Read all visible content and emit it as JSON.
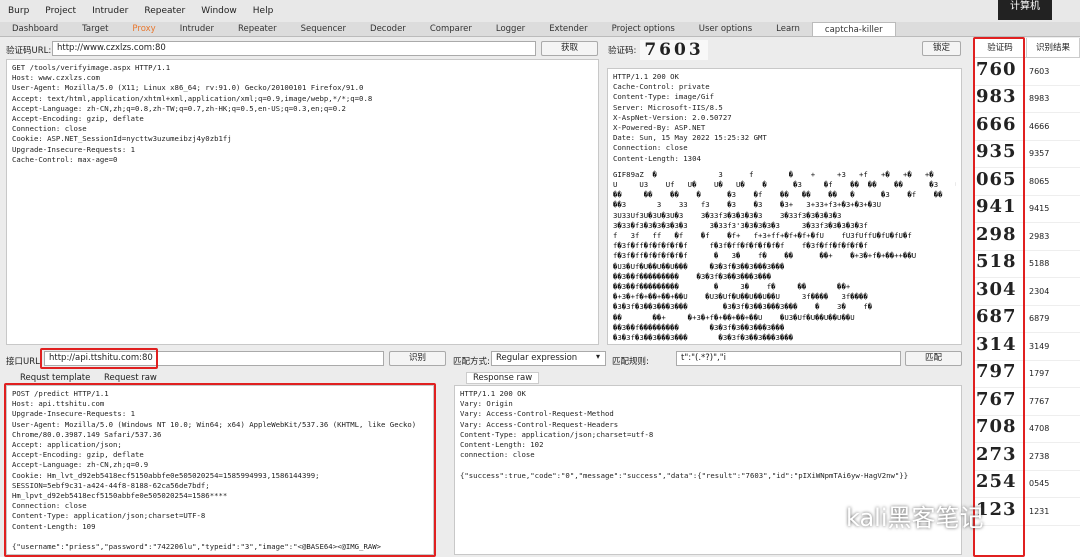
{
  "menu": [
    "Burp",
    "Project",
    "Intruder",
    "Repeater",
    "Window",
    "Help"
  ],
  "corner_text": "计算机",
  "tabs": [
    {
      "label": "Dashboard"
    },
    {
      "label": "Target"
    },
    {
      "label": "Proxy"
    },
    {
      "label": "Intruder"
    },
    {
      "label": "Repeater"
    },
    {
      "label": "Sequencer"
    },
    {
      "label": "Decoder"
    },
    {
      "label": "Comparer"
    },
    {
      "label": "Logger"
    },
    {
      "label": "Extender"
    },
    {
      "label": "Project options"
    },
    {
      "label": "User options"
    },
    {
      "label": "Learn"
    },
    {
      "label": "captcha-killer"
    }
  ],
  "captcha_url": {
    "label": "验证码URL:",
    "value": "http://www.czxlzs.com:80",
    "fetch": "获取"
  },
  "captcha_img": {
    "label": "验证码:",
    "text": "7603",
    "lock": "锁定"
  },
  "request_text": "GET /tools/verifyimage.aspx HTTP/1.1\nHost: www.czxlzs.com\nUser-Agent: Mozilla/5.0 (X11; Linux x86_64; rv:91.0) Gecko/20100101 Firefox/91.0\nAccept: text/html,application/xhtml+xml,application/xml;q=0.9,image/webp,*/*;q=0.8\nAccept-Language: zh-CN,zh;q=0.8,zh-TW;q=0.7,zh-HK;q=0.5,en-US;q=0.3,en;q=0.2\nAccept-Encoding: gzip, deflate\nConnection: close\nCookie: ASP.NET_SessionId=nycttw3uzumeibzj4y0zb1fj\nUpgrade-Insecure-Requests: 1\nCache-Control: max-age=0",
  "response_head": "HTTP/1.1 200 OK\nCache-Control: private\nContent-Type: image/Gif\nServer: Microsoft-IIS/8.5\nX-AspNet-Version: 2.0.50727\nX-Powered-By: ASP.NET\nDate: Sun, 15 May 2022 15:25:32 GMT\nConnection: close\nContent-Length: 1304",
  "response_binary": "GIF89aZ  �              3      f        �    +     +3   +f   +�   +�   +�\nU     U3    Uf   U�    U�   U�    �      �3     �f    ��  ��    ��      �3    �f\n��     ��    ��    �      �3    �f    ��   ��    ��   �      �3    �f    ��    ��\n��3       3    33   f3    �3    �3    �3+   3+33+f3+�3+�3+�3U\n3U33Uf3U�3U�3U�3    3�33f3�3�3�3�3    3�33f3�3�3�3�3\n3�33�f3�3�3�3�3�3     3�33f3'3�3�3�3�3     3�33f3�3�3�3�3f\nf   3f   ff   �f    �f    �f+   f+3+ff+�f+�f+�fU    fU3fUffU�fU�fU�f\nf�3f�ff�f�f�f�f�f     f�3f�ff�f�f�f�f�f    f�3f�ff�f�f�f�f\nf�3f�ff�f�f�f�f�f      �   3�    f�    ��      ��+    �+3�+f�+��++��U\n�U3�Uf�U��U��U���     �3�3f�3��3���3���\n��3��f���������    �3�3f�3��3���3���\n��3��f���������        �     3�    f�     ��       ��+\n�+3�+f�+��+��+��U    �U3�Uf�U��U��U��U     3f����   3f����\n�3�3f�3��3���3���        �3�3f�3��3���3���    �    3�    f�\n��       ��+     �+3�+f�+��+��+��U    �U3�Uf�U��U��U��U\n��3��f���������       �3�3f�3��3���3���\n�3�3f�3��3���3���       �3�3f�3��3���3���",
  "api_url": {
    "label": "接口URL:",
    "value": "http://api.ttshitu.com:80",
    "identify": "识别"
  },
  "match": {
    "mode_label": "匹配方式:",
    "mode_value": "Regular expression",
    "rule_label": "匹配规则:",
    "rule_value": "t\":\"(.*?)\",\"i",
    "button": "匹配"
  },
  "request_tabs": [
    "Requst template",
    "Request raw"
  ],
  "response_tab": "Response raw",
  "api_request": "POST /predict HTTP/1.1\nHost: api.ttshitu.com\nUpgrade-Insecure-Requests: 1\nUser-Agent: Mozilla/5.0 (Windows NT 10.0; Win64; x64) AppleWebKit/537.36 (KHTML, like Gecko)\nChrome/80.0.3987.149 Safari/537.36\nAccept: application/json;\nAccept-Encoding: gzip, deflate\nAccept-Language: zh-CN,zh;q=0.9\nCookie: Hm_lvt_d92eb5418ecf5150abbfe0e505020254=1585994993,1586144399;\nSESSION=5ebf9c31-a424-44f8-8188-62ca56de7bdf; Hm_lpvt_d92eb5418ecf5150abbfe0e505020254=1586****\nConnection: close\nContent-Type: application/json;charset=UTF-8\nContent-Length: 109\n\n{\"username\":\"priess\",\"password\":\"742206lu\",\"typeid\":\"3\",\"image\":\"<@BASE64><@IMG_RAW></@IMG_RAW></@\nBASE64>\"}",
  "api_response": "HTTP/1.1 200 OK\nVary: Origin\nVary: Access-Control-Request-Method\nVary: Access-Control-Request-Headers\nContent-Type: application/json;charset=utf-8\nContent-Length: 102\nconnection: close\n\n{\"success\":true,\"code\":\"0\",\"message\":\"success\",\"data\":{\"result\":\"7603\",\"id\":\"pIXiWNpmTAi6yw-HagV2nw\"}}",
  "results": {
    "col1": "验证码",
    "col2": "识别结果",
    "rows": [
      {
        "img": "760",
        "val": "7603"
      },
      {
        "img": "983",
        "val": "8983"
      },
      {
        "img": "666",
        "val": "4666"
      },
      {
        "img": "935",
        "val": "9357"
      },
      {
        "img": "065",
        "val": "8065"
      },
      {
        "img": "941",
        "val": "9415"
      },
      {
        "img": "298",
        "val": "2983"
      },
      {
        "img": "518",
        "val": "5188"
      },
      {
        "img": "304",
        "val": "2304"
      },
      {
        "img": "687",
        "val": "6879"
      },
      {
        "img": "314",
        "val": "3149"
      },
      {
        "img": "797",
        "val": "1797"
      },
      {
        "img": "767",
        "val": "7767"
      },
      {
        "img": "708",
        "val": "4708"
      },
      {
        "img": "273",
        "val": "2738"
      },
      {
        "img": "254",
        "val": "0545"
      },
      {
        "img": "123",
        "val": "1231"
      }
    ]
  },
  "watermark": "kali黑客笔记"
}
